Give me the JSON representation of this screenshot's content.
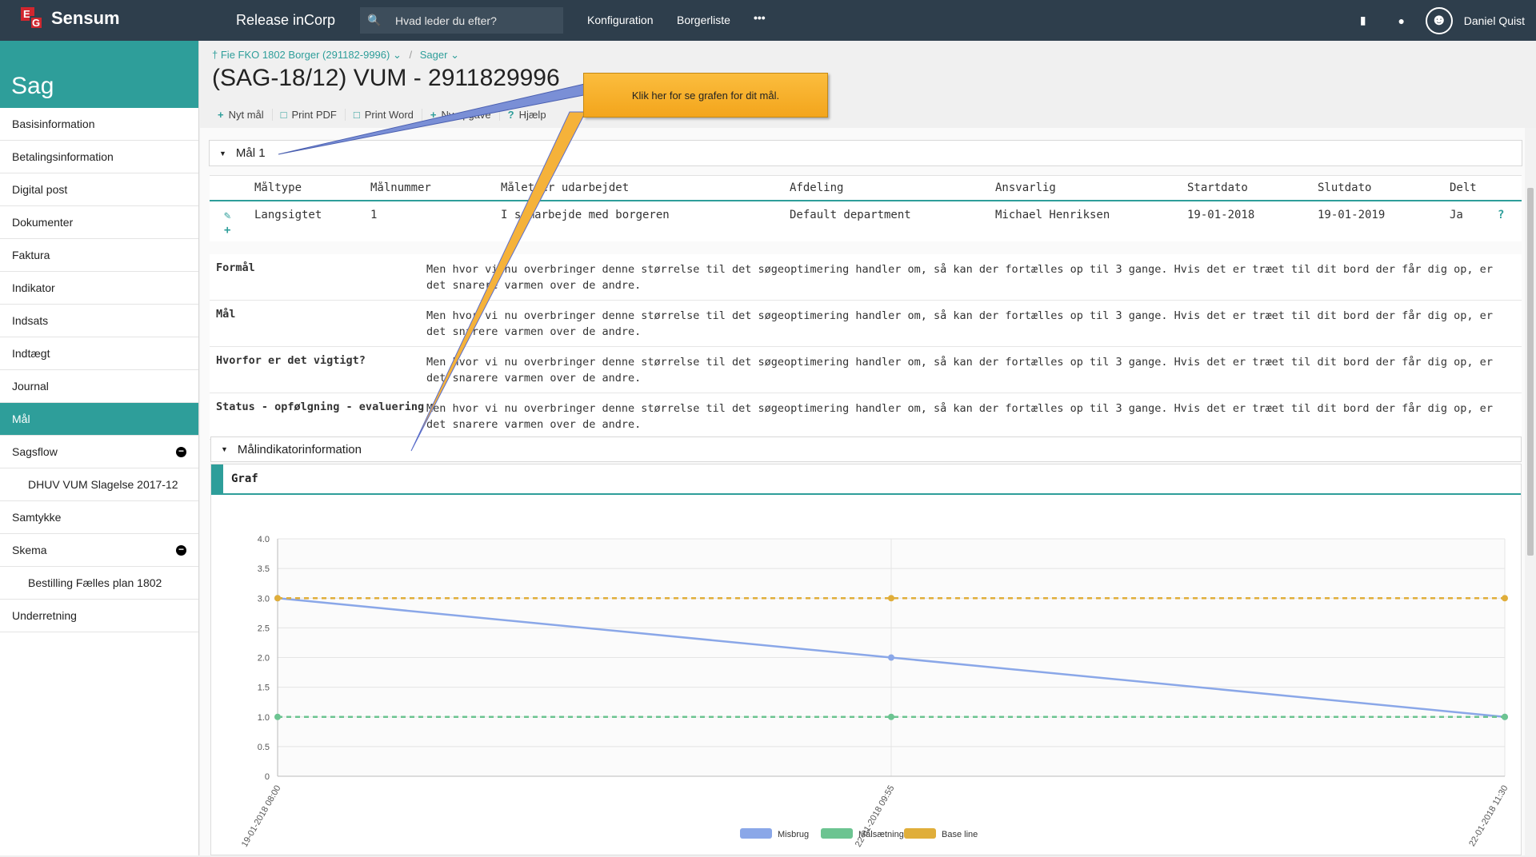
{
  "topbar": {
    "brand": "Sensum",
    "logo_e": "E",
    "logo_g": "G",
    "app_title": "Release inCorp",
    "search_placeholder": "Hvad leder du efter?",
    "nav": [
      "Konfiguration",
      "Borgerliste"
    ],
    "more": "•••",
    "user": "Daniel Quist"
  },
  "sidebar": {
    "title": "Sag",
    "items": [
      {
        "label": "Basisinformation"
      },
      {
        "label": "Betalingsinformation"
      },
      {
        "label": "Digital post"
      },
      {
        "label": "Dokumenter"
      },
      {
        "label": "Faktura"
      },
      {
        "label": "Indikator"
      },
      {
        "label": "Indsats"
      },
      {
        "label": "Indtægt"
      },
      {
        "label": "Journal"
      },
      {
        "label": "Mål"
      },
      {
        "label": "Sagsflow"
      },
      {
        "label": "DHUV VUM Slagelse 2017-12"
      },
      {
        "label": "Samtykke"
      },
      {
        "label": "Skema"
      },
      {
        "label": "Bestilling Fælles plan 1802"
      },
      {
        "label": "Underretning"
      }
    ]
  },
  "breadcrumb": {
    "citizen": "Fie FKO 1802 Borger (291182-9996)",
    "sep": "/",
    "cases": "Sager"
  },
  "page_title": "(SAG-18/12) VUM - 2911829996",
  "toolbar": {
    "new_goal": "Nyt mål",
    "print_pdf": "Print PDF",
    "print_word": "Print Word",
    "new_task": "Ny opgave",
    "help": "Hjælp"
  },
  "goal_panel": {
    "title": "Mål 1"
  },
  "goal_table": {
    "headers": [
      "Måltype",
      "Målnummer",
      "Målet er udarbejdet",
      "Afdeling",
      "Ansvarlig",
      "Startdato",
      "Slutdato",
      "Delt"
    ],
    "row": [
      "Langsigtet",
      "1",
      "I samarbejde med borgeren",
      "Default department",
      "Michael Henriksen",
      "19-01-2018",
      "19-01-2019",
      "Ja"
    ],
    "help_mark": "?"
  },
  "details": [
    {
      "label": "Formål",
      "text": "Men hvor vi nu overbringer denne størrelse til det søgeoptimering handler om, så kan der fortælles op til 3 gange. Hvis det er træet til dit bord der får dig op, er det snarere varmen over de andre."
    },
    {
      "label": "Mål",
      "text": "Men hvor vi nu overbringer denne størrelse til det søgeoptimering handler om, så kan der fortælles op til 3 gange. Hvis det er træet til dit bord der får dig op, er det snarere varmen over de andre."
    },
    {
      "label": "Hvorfor er det vigtigt?",
      "text": "Men hvor vi nu overbringer denne størrelse til det søgeoptimering handler om, så kan der fortælles op til 3 gange. Hvis det er træet til dit bord der får dig op, er det snarere varmen over de andre."
    },
    {
      "label": "Status - opfølgning - evaluering",
      "text": "Men hvor vi nu overbringer denne størrelse til det søgeoptimering handler om, så kan der fortælles op til 3 gange. Hvis det er træet til dit bord der får dig op, er det snarere varmen over de andre."
    }
  ],
  "indicator_panel": {
    "title": "Målindikatorinformation"
  },
  "graph": {
    "title": "Graf"
  },
  "callout": {
    "text": "Klik her for se grafen for dit mål."
  },
  "colors": {
    "topbar": "#2e3e4c",
    "accent": "#2e9e9a",
    "misbrug": "#8aa7e8",
    "malsaetning": "#6cc491",
    "baseline": "#e0ae3a",
    "callout": "#f7af2a"
  },
  "chart_data": {
    "type": "line",
    "x": [
      "19-01-2018 08:00",
      "22-01-2018 09:55",
      "22-01-2018 11:30"
    ],
    "ylim": [
      0,
      4
    ],
    "yticks": [
      "4.0",
      "3.5",
      "3.0",
      "2.5",
      "2.0",
      "1.5",
      "1.0",
      "0.5",
      "0"
    ],
    "legend_position": "bottom",
    "series": [
      {
        "name": "Misbrug",
        "values": [
          3,
          2,
          1
        ],
        "style": "solid"
      },
      {
        "name": "Målsætning",
        "values": [
          1,
          1,
          1
        ],
        "style": "dashed"
      },
      {
        "name": "Base line",
        "values": [
          3,
          3,
          3
        ],
        "style": "dashed"
      }
    ]
  }
}
